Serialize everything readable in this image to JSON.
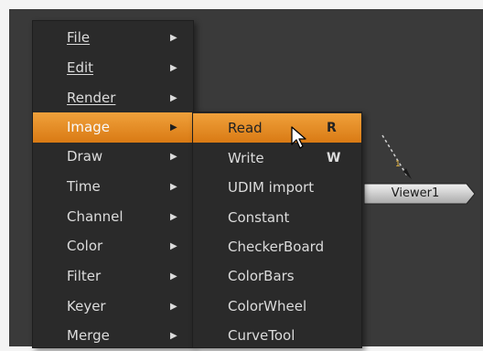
{
  "menu": {
    "items": [
      {
        "label": "File",
        "arrow": "▶"
      },
      {
        "label": "Edit",
        "arrow": "▶"
      },
      {
        "label": "Render",
        "arrow": "▶"
      },
      {
        "label": "Image",
        "arrow": "▶"
      },
      {
        "label": "Draw",
        "arrow": "▶"
      },
      {
        "label": "Time",
        "arrow": "▶"
      },
      {
        "label": "Channel",
        "arrow": "▶"
      },
      {
        "label": "Color",
        "arrow": "▶"
      },
      {
        "label": "Filter",
        "arrow": "▶"
      },
      {
        "label": "Keyer",
        "arrow": "▶"
      },
      {
        "label": "Merge",
        "arrow": "▶"
      }
    ],
    "highlighted": "Image"
  },
  "submenu": {
    "items": [
      {
        "label": "Read",
        "shortcut": "R"
      },
      {
        "label": "Write",
        "shortcut": "W"
      },
      {
        "label": "UDIM import",
        "shortcut": ""
      },
      {
        "label": "Constant",
        "shortcut": ""
      },
      {
        "label": "CheckerBoard",
        "shortcut": ""
      },
      {
        "label": "ColorBars",
        "shortcut": ""
      },
      {
        "label": "ColorWheel",
        "shortcut": ""
      },
      {
        "label": "CurveTool",
        "shortcut": ""
      }
    ],
    "highlighted": "Read"
  },
  "node": {
    "label": "Viewer1",
    "input_number": "1"
  },
  "colors": {
    "highlight": "#e8901f",
    "menu_bg": "#2a2a2a",
    "canvas_bg": "#3a3a3a"
  }
}
